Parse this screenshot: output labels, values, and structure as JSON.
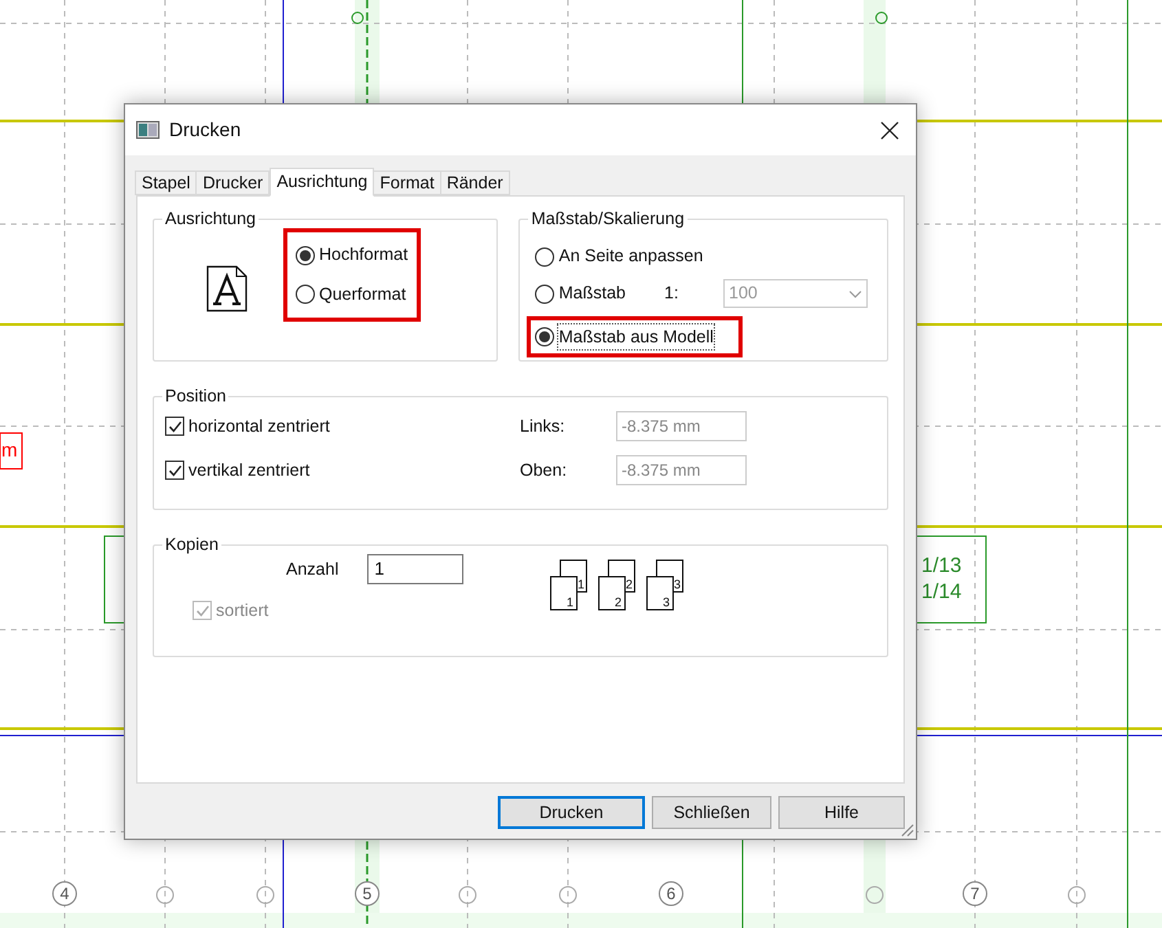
{
  "canvas": {
    "red_tag": "m",
    "green_tags": [
      "1/13",
      "1/14"
    ],
    "axis_labels": [
      "4",
      "5",
      "6",
      "7"
    ]
  },
  "dialog": {
    "title": "Drucken",
    "tabs": [
      {
        "label": "Stapel",
        "selected": false
      },
      {
        "label": "Drucker",
        "selected": false
      },
      {
        "label": "Ausrichtung",
        "selected": true
      },
      {
        "label": "Format",
        "selected": false
      },
      {
        "label": "Ränder",
        "selected": false
      }
    ],
    "orientation": {
      "title": "Ausrichtung",
      "highlighted": true,
      "options": [
        {
          "label": "Hochformat",
          "selected": true
        },
        {
          "label": "Querformat",
          "selected": false
        }
      ]
    },
    "scale": {
      "title": "Maßstab/Skalierung",
      "options": [
        {
          "label": "An Seite anpassen",
          "selected": false,
          "kind": "plain",
          "highlighted": false,
          "focused": false
        },
        {
          "label": "Maßstab",
          "selected": false,
          "kind": "ratio",
          "prefix": "1:",
          "value": "100",
          "highlighted": false,
          "focused": false
        },
        {
          "label": "Maßstab aus Modell",
          "selected": true,
          "kind": "plain",
          "highlighted": true,
          "focused": true
        }
      ]
    },
    "position": {
      "title": "Position",
      "checks": [
        {
          "label": "horizontal zentriert",
          "checked": true
        },
        {
          "label": "vertikal zentriert",
          "checked": true
        }
      ],
      "fields": [
        {
          "label": "Links:",
          "value": "-8.375 mm",
          "disabled": true
        },
        {
          "label": "Oben:",
          "value": "-8.375 mm",
          "disabled": true
        }
      ]
    },
    "copies": {
      "title": "Kopien",
      "count_label": "Anzahl",
      "count": "1",
      "collate": {
        "label": "sortiert",
        "checked": true,
        "disabled": true
      },
      "stacks": [
        {
          "back": "1",
          "front": "1"
        },
        {
          "back": "2",
          "front": "2"
        },
        {
          "back": "3",
          "front": "3"
        }
      ]
    },
    "buttons": [
      {
        "label": "Drucken",
        "default": true
      },
      {
        "label": "Schließen",
        "default": false
      },
      {
        "label": "Hilfe",
        "default": false
      }
    ]
  }
}
